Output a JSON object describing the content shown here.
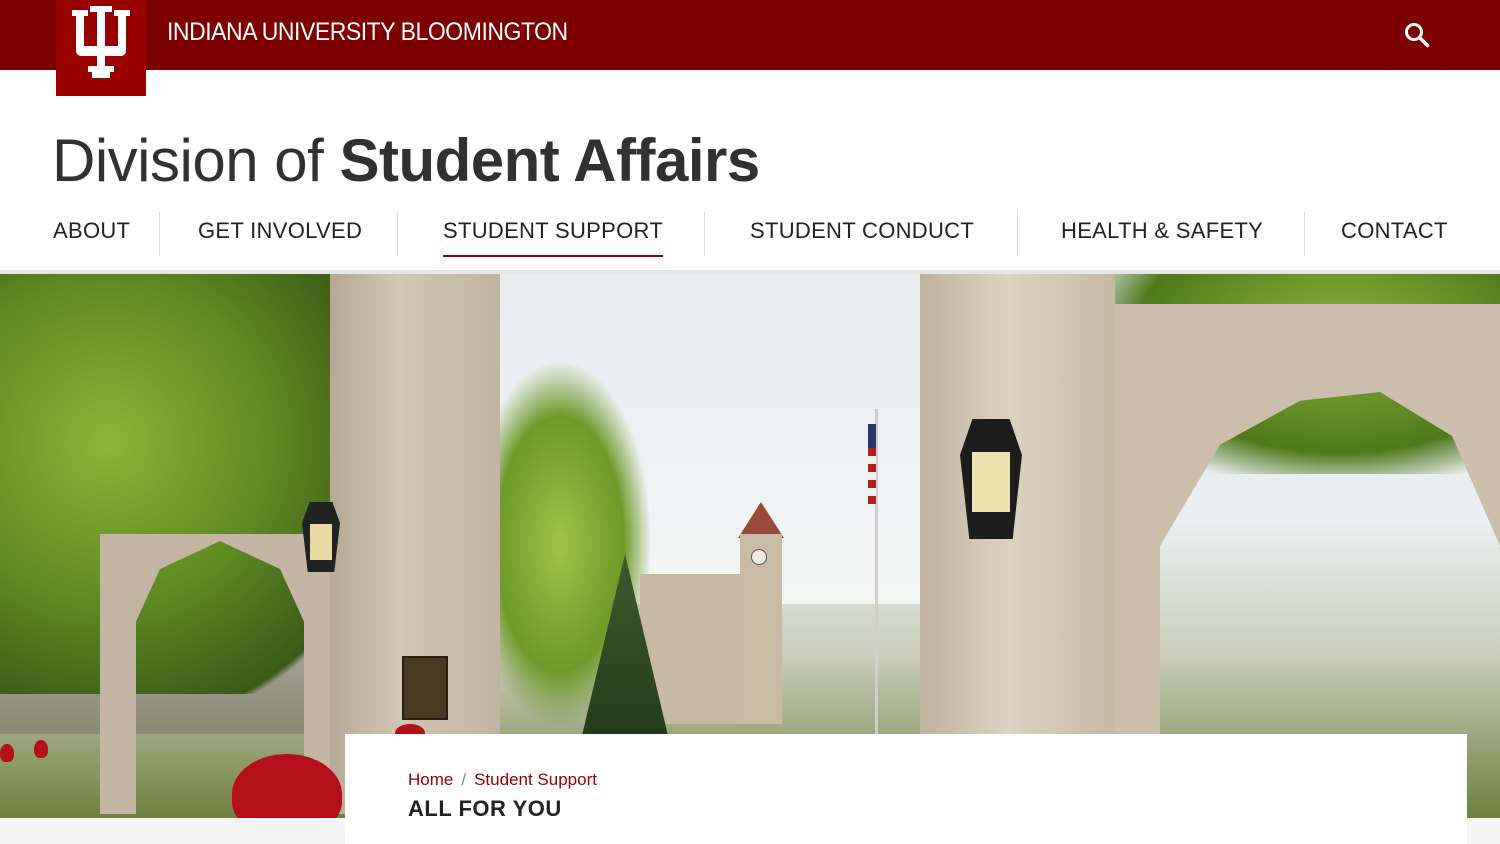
{
  "header": {
    "university_name": "INDIANA UNIVERSITY BLOOMINGTON",
    "logo_icon": "trident-logo-icon",
    "search_icon": "search-icon",
    "brand_color": "#990000",
    "bar_color": "#7d0000"
  },
  "site": {
    "title_light": "Division of ",
    "title_bold": "Student Affairs"
  },
  "nav": {
    "items": [
      {
        "label": "ABOUT"
      },
      {
        "label": "GET INVOLVED"
      },
      {
        "label": "STUDENT SUPPORT",
        "active": true
      },
      {
        "label": "STUDENT CONDUCT"
      },
      {
        "label": "HEALTH & SAFETY"
      },
      {
        "label": "CONTACT"
      }
    ]
  },
  "breadcrumb": {
    "home": "Home",
    "separator": "/",
    "current": "Student Support"
  },
  "page": {
    "heading": "ALL FOR YOU"
  }
}
